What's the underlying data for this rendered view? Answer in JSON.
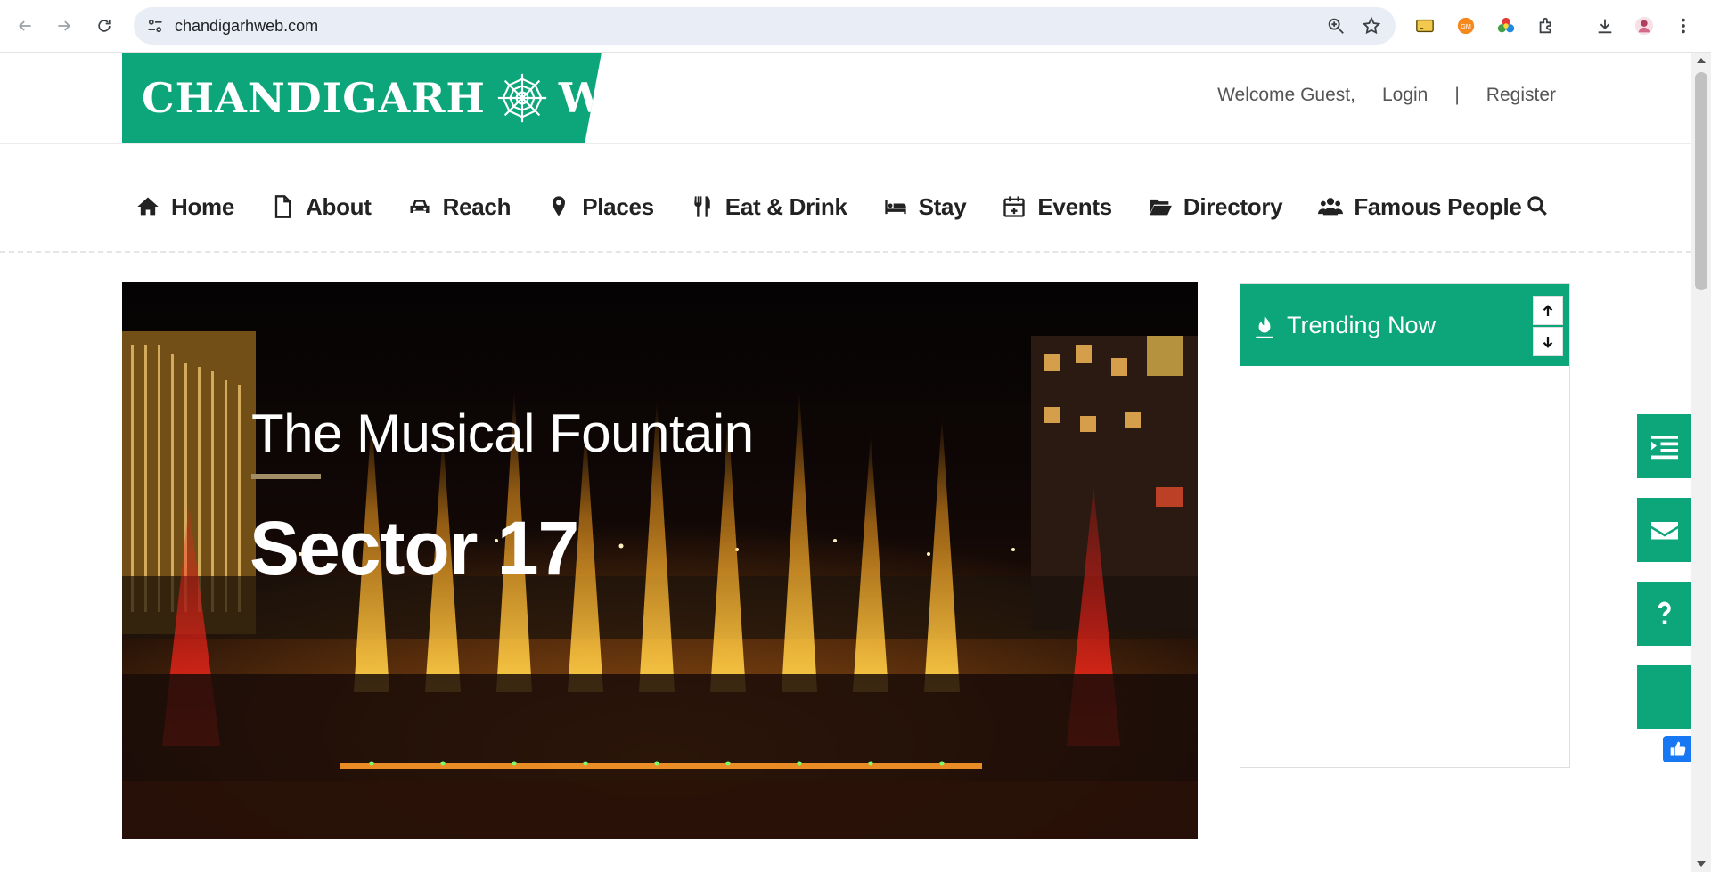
{
  "browser": {
    "url": "chandigarhweb.com",
    "back_icon": "arrow-left-icon",
    "forward_icon": "arrow-right-icon",
    "reload_icon": "reload-icon"
  },
  "site": {
    "logo_text_left": "CHANDIGARH",
    "logo_text_right": "WEB",
    "brand_color": "#0ca67a"
  },
  "user": {
    "welcome": "Welcome Guest,",
    "login": "Login",
    "separator": "|",
    "register": "Register"
  },
  "nav": {
    "items": [
      {
        "label": "Home",
        "icon": "home-icon"
      },
      {
        "label": "About",
        "icon": "file-icon"
      },
      {
        "label": "Reach",
        "icon": "car-icon"
      },
      {
        "label": "Places",
        "icon": "map-pin-icon"
      },
      {
        "label": "Eat & Drink",
        "icon": "cutlery-icon"
      },
      {
        "label": "Stay",
        "icon": "bed-icon"
      },
      {
        "label": "Events",
        "icon": "calendar-plus-icon"
      },
      {
        "label": "Directory",
        "icon": "folder-open-icon"
      },
      {
        "label": "Famous People",
        "icon": "users-icon"
      }
    ]
  },
  "hero": {
    "subtitle": "The Musical Fountain",
    "title": "Sector 17",
    "accent_bar_color": "#a28e66"
  },
  "trending": {
    "title": "Trending Now"
  }
}
